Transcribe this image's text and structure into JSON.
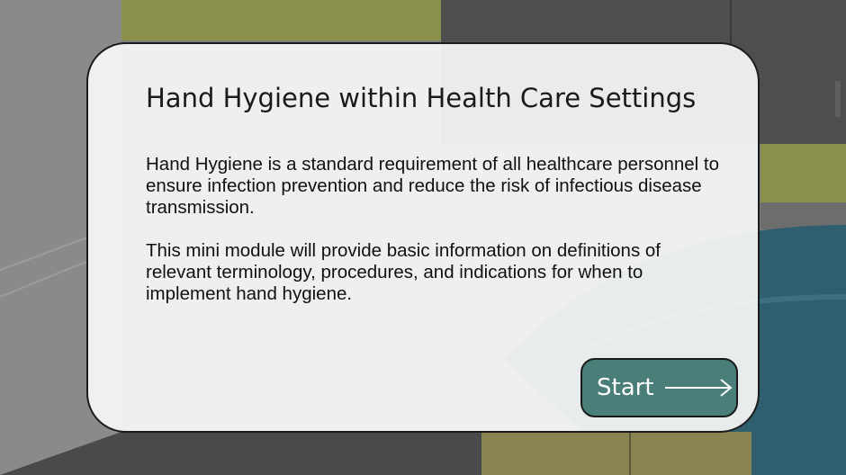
{
  "card": {
    "title": "Hand Hygiene within Health Care Settings",
    "paragraph_1": "Hand Hygiene is a standard requirement of all healthcare personnel to ensure infection prevention and reduce the risk of infectious disease transmission.",
    "paragraph_2": "This mini module will provide basic information on definitions of relevant terminology, procedures, and indications for when to implement hand hygiene."
  },
  "start_button": {
    "label": "Start",
    "icon": "arrow-right-icon"
  },
  "colors": {
    "button_fill": "#4a7f79",
    "wall_green": "#8a8f4a",
    "counter_blue": "#2f5e6e"
  }
}
